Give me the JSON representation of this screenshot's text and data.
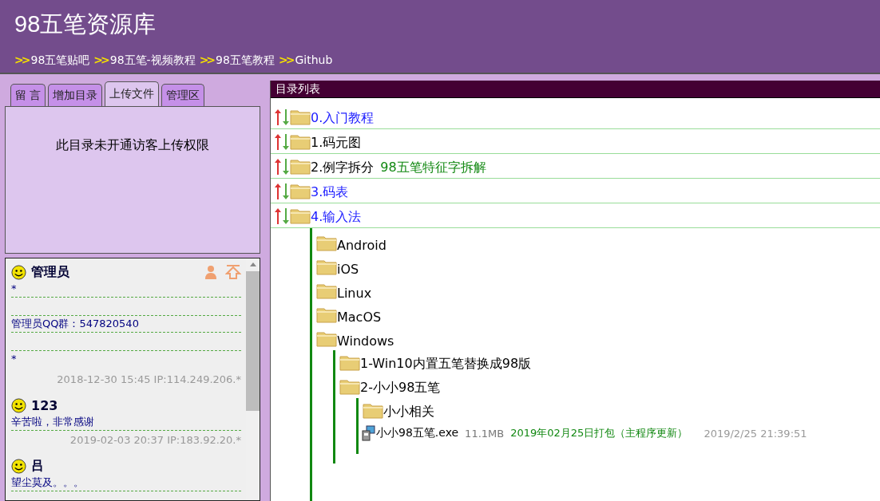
{
  "site_title": "98五笔资源库",
  "nav_links": [
    {
      "marker": ">>",
      "label": "98五笔贴吧"
    },
    {
      "marker": ">>",
      "label": "98五笔-视频教程"
    },
    {
      "marker": ">>",
      "label": "98五笔教程"
    },
    {
      "marker": ">>",
      "label": "Github"
    }
  ],
  "tabs": [
    {
      "label": "留 言",
      "selected": false
    },
    {
      "label": "增加目录",
      "selected": false
    },
    {
      "label": "上传文件",
      "selected": true
    },
    {
      "label": "管理区",
      "selected": false
    }
  ],
  "tab_panel": {
    "message": "此目录未开通访客上传权限"
  },
  "messages": [
    {
      "name": "管理员",
      "admin": true,
      "body": [
        {
          "kind": "text",
          "text": "*"
        },
        {
          "kind": "rule"
        },
        {
          "kind": "rule"
        },
        {
          "kind": "text",
          "text": "管理员QQ群：547820540"
        },
        {
          "kind": "rule"
        },
        {
          "kind": "rule"
        },
        {
          "kind": "text",
          "text": "*"
        }
      ],
      "meta": "2018-12-30 15:45 IP:114.249.206.*"
    },
    {
      "name": "123",
      "admin": false,
      "body": [
        {
          "kind": "text",
          "text": "辛苦啦，非常感谢"
        },
        {
          "kind": "rule"
        }
      ],
      "meta": "2019-02-03 20:37 IP:183.92.20.*"
    },
    {
      "name": "吕",
      "admin": false,
      "body": [
        {
          "kind": "text",
          "text": "望尘莫及。。。"
        },
        {
          "kind": "rule"
        }
      ]
    }
  ],
  "directory": {
    "title": "目录列表",
    "items": [
      {
        "kind": "folder",
        "label": "0.入门教程",
        "visited": false,
        "sortable": true
      },
      {
        "kind": "folder",
        "label": "1.码元图",
        "visited": true,
        "sortable": true
      },
      {
        "kind": "folder",
        "label": "2.例字拆分",
        "visited": true,
        "sortable": true,
        "note": "98五笔特征字拆解"
      },
      {
        "kind": "folder",
        "label": "3.码表",
        "visited": false,
        "sortable": true
      },
      {
        "kind": "folder",
        "label": "4.输入法",
        "visited": false,
        "sortable": true,
        "expanded": true,
        "children": [
          {
            "kind": "folder",
            "label": "Android",
            "visited": true
          },
          {
            "kind": "folder",
            "label": "iOS",
            "visited": true
          },
          {
            "kind": "folder",
            "label": "Linux",
            "visited": true
          },
          {
            "kind": "folder",
            "label": "MacOS",
            "visited": true
          },
          {
            "kind": "folder",
            "label": "Windows",
            "visited": true,
            "expanded": true,
            "children": [
              {
                "kind": "folder",
                "label": "1-Win10内置五笔替换成98版",
                "visited": true
              },
              {
                "kind": "folder",
                "label": "2-小小98五笔",
                "visited": true,
                "expanded": true,
                "children": [
                  {
                    "kind": "folder",
                    "label": "小小相关",
                    "visited": true
                  },
                  {
                    "kind": "file",
                    "label": "小小98五笔.exe",
                    "visited": true,
                    "size": "11.1MB",
                    "note": "2019年02月25日打包（主程序更新）",
                    "date": "2019/2/25 21:39:51"
                  }
                ]
              }
            ]
          }
        ]
      }
    ]
  }
}
